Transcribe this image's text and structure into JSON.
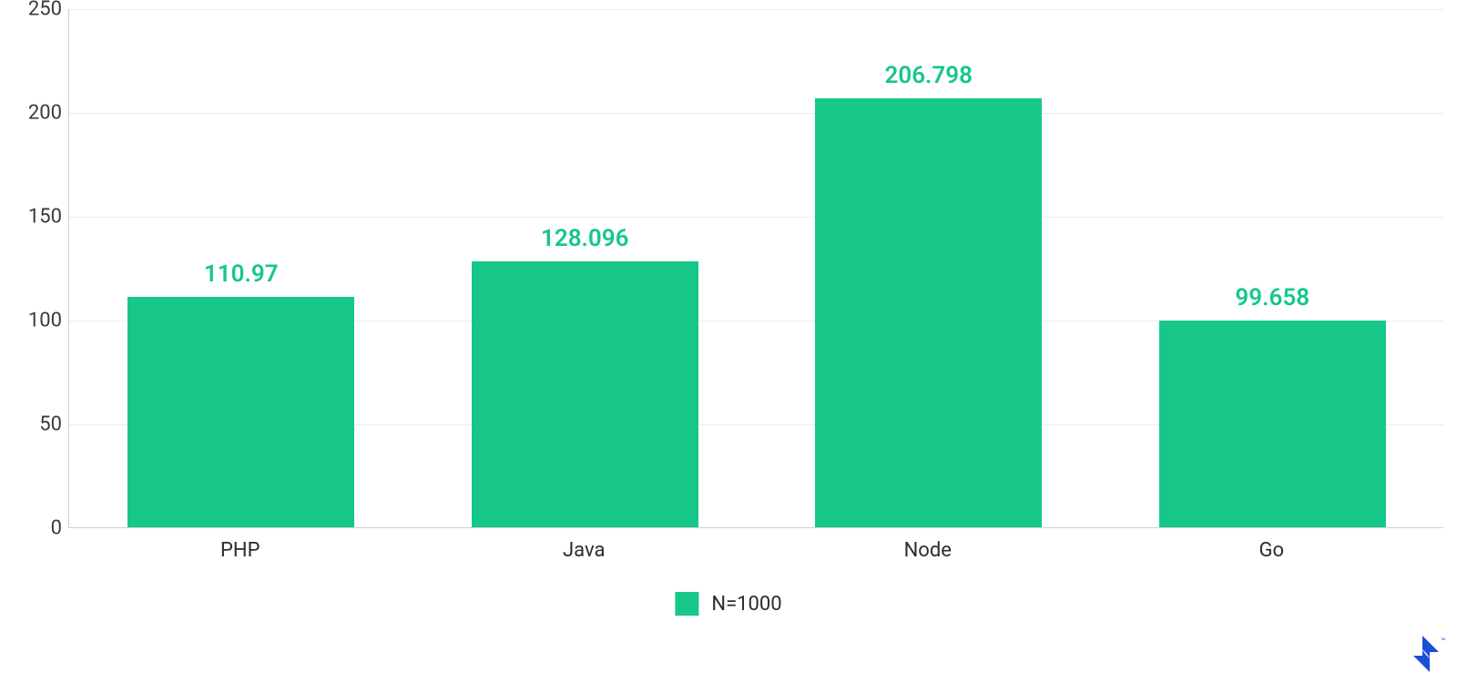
{
  "chart_data": {
    "type": "bar",
    "categories": [
      "PHP",
      "Java",
      "Node",
      "Go"
    ],
    "values": [
      110.97,
      128.096,
      206.798,
      99.658
    ],
    "series_name": "N=1000",
    "ylim": [
      0,
      250
    ],
    "y_ticks": [
      0,
      50,
      100,
      150,
      200,
      250
    ],
    "bar_color": "#17c788"
  },
  "legend": {
    "label": "N=1000"
  },
  "watermark": {
    "trademark": "™"
  }
}
